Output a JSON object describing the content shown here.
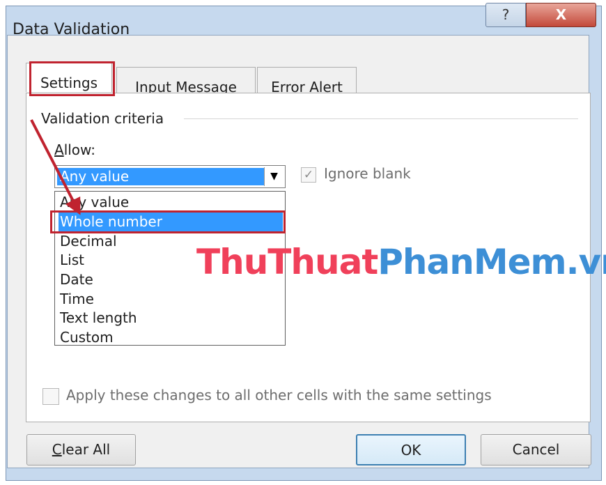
{
  "window": {
    "title": "Data Validation",
    "help_label": "?",
    "close_label": "X"
  },
  "tabs": [
    {
      "label": "Settings"
    },
    {
      "label": "Input Message"
    },
    {
      "label": "Error Alert"
    }
  ],
  "settings": {
    "section_label": "Validation criteria",
    "allow_label_accel": "A",
    "allow_label_rest": "llow:",
    "allow_value": "Any value",
    "ignore_blank_label": "Ignore blank",
    "ignore_blank_checked": true,
    "options": [
      {
        "label": "Any value"
      },
      {
        "label": "Whole number",
        "selected": true
      },
      {
        "label": "Decimal"
      },
      {
        "label": "List"
      },
      {
        "label": "Date"
      },
      {
        "label": "Time"
      },
      {
        "label": "Text length"
      },
      {
        "label": "Custom"
      }
    ],
    "apply_label": "Apply these changes to all other cells with the same settings",
    "apply_checked": false
  },
  "watermark": {
    "part1": "ThuThuat",
    "part2": "PhanMem.vn"
  },
  "buttons": {
    "clear_accel": "C",
    "clear_rest": "lear All",
    "ok": "OK",
    "cancel": "Cancel"
  },
  "colors": {
    "selection": "#3399ff",
    "annotation_red": "#c0232f",
    "watermark_pink": "#f0405a",
    "watermark_blue": "#3d8fd6"
  }
}
